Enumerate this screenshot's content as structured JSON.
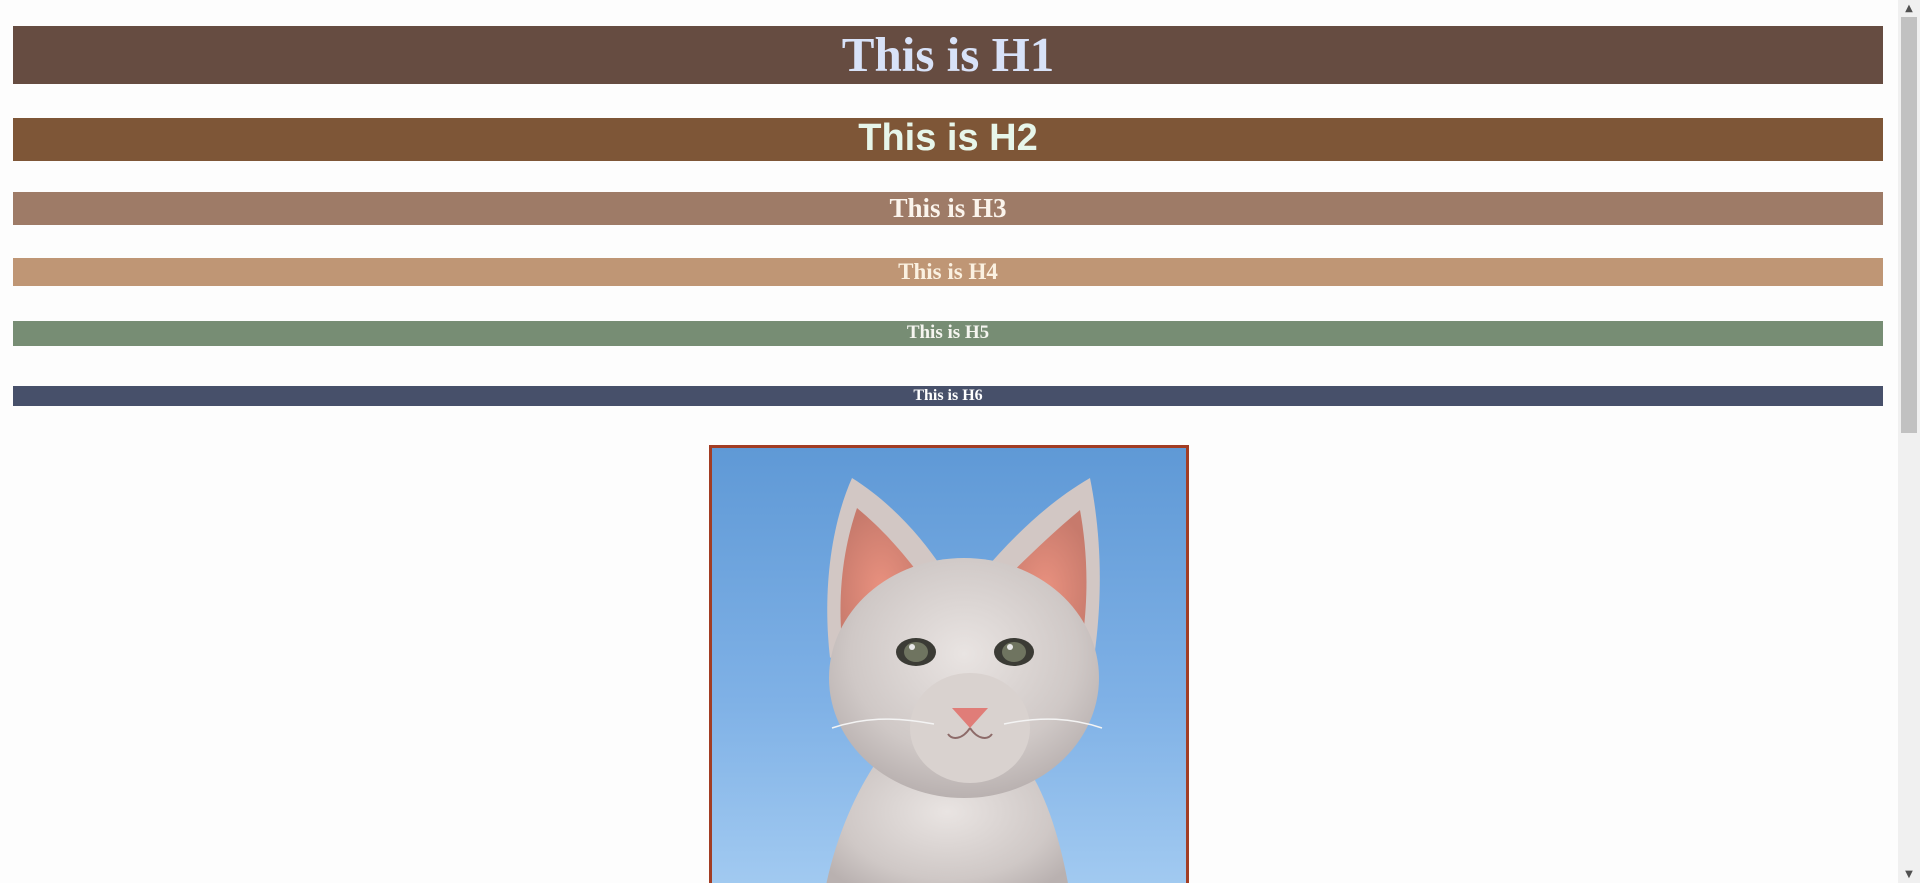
{
  "headings": [
    {
      "level": "h1",
      "text": "This is H1",
      "bg": "#664c41",
      "color": "#d8e2f8"
    },
    {
      "level": "h2",
      "text": "This is H2",
      "bg": "#7e5637",
      "color": "#e7f6ea"
    },
    {
      "level": "h3",
      "text": "This is H3",
      "bg": "#9e7b67",
      "color": "#fbf4ec"
    },
    {
      "level": "h4",
      "text": "This is H4",
      "bg": "#bf9675",
      "color": "#fbf1e1"
    },
    {
      "level": "h5",
      "text": "This is H5",
      "bg": "#778d74",
      "color": "#f5f5f0"
    },
    {
      "level": "h6",
      "text": "This is H6",
      "bg": "#47506a",
      "color": "#ffffff"
    }
  ],
  "image": {
    "subject": "white kitten against blue sky",
    "border_color": "#a23d24"
  },
  "scrollbar": {
    "up_icon": "chevron-up-icon",
    "down_icon": "chevron-down-icon"
  }
}
